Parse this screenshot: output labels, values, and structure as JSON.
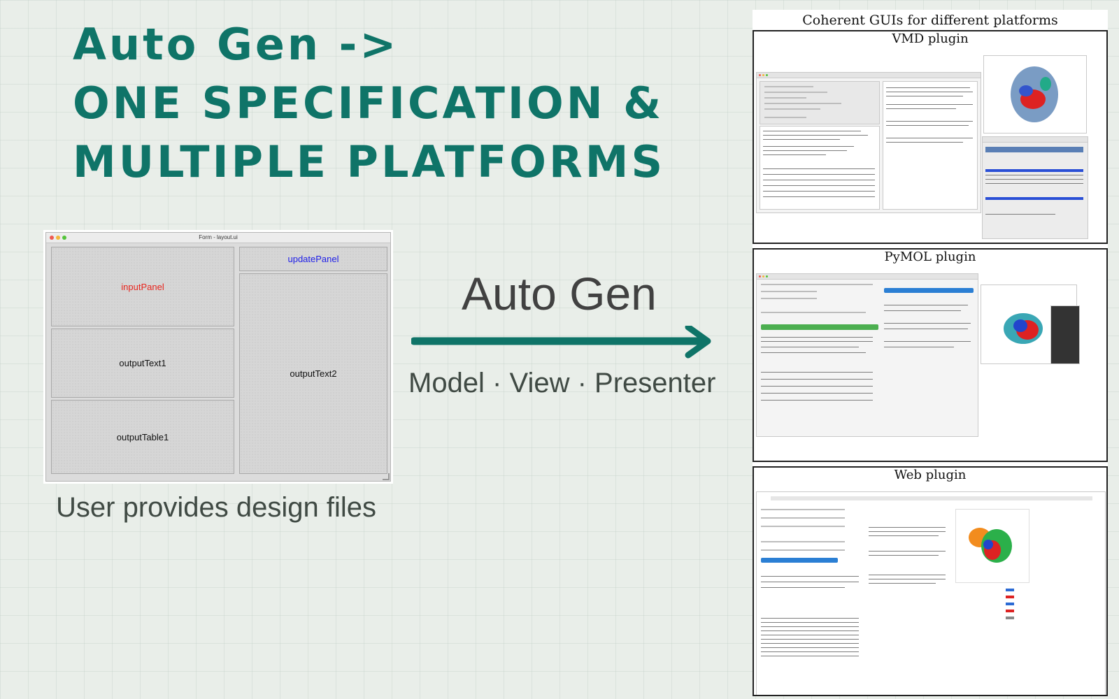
{
  "headline": {
    "line1": "Auto Gen ->",
    "line2": "ONE SPECIFICATION &",
    "line3": "MULTIPLE PLATFORMS"
  },
  "designer": {
    "window_title": "Form - layout.ui",
    "panels": {
      "input": "inputPanel",
      "update": "updatePanel",
      "output_text1": "outputText1",
      "output_text2": "outputText2",
      "output_table1": "outputTable1"
    },
    "colors": {
      "input_label": "#e8261e",
      "update_label": "#1e1ee8"
    }
  },
  "caption_left": "User provides design files",
  "center": {
    "auto_gen": "Auto Gen",
    "mvp": "Model · View · Presenter"
  },
  "figure": {
    "title": "Coherent GUIs for different platforms",
    "plugins": [
      {
        "name": "VMD plugin"
      },
      {
        "name": "PyMOL plugin"
      },
      {
        "name": "Web plugin"
      }
    ]
  },
  "colors": {
    "accent": "#0f7468",
    "arrow": "#0f7468",
    "caption": "#404a44"
  }
}
